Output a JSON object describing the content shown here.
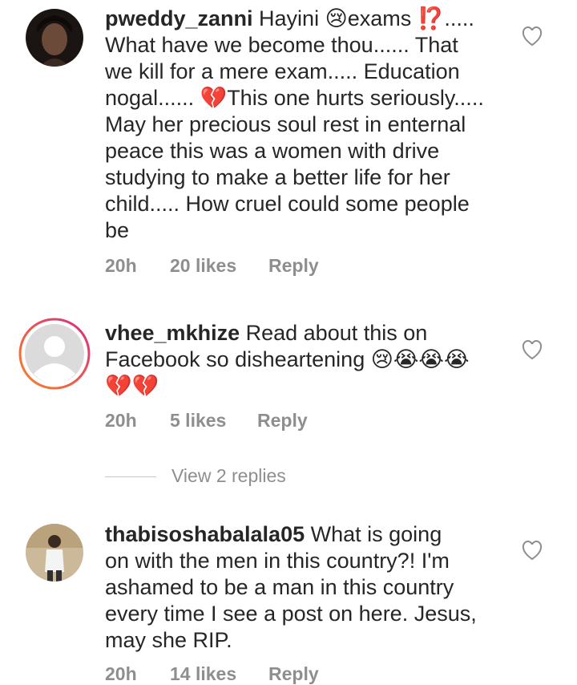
{
  "comments": [
    {
      "username": "pweddy_zanni",
      "text_lines": [
        "Hayini 😢exams ⁉️.....",
        "What have we become thou...... That",
        "we kill for a mere exam..... Education",
        "nogal...... 💔This one hurts seriously.....",
        "May her precious soul rest in enternal",
        "peace this was a women with drive",
        "studying to make a better life for her",
        "child..... How cruel could some people",
        "be"
      ],
      "time": "20h",
      "likes": "20 likes",
      "reply": "Reply"
    },
    {
      "username": "vhee_mkhize",
      "text_lines": [
        "Read about this on",
        "Facebook so disheartening 😢😭😭😭",
        "💔💔"
      ],
      "time": "20h",
      "likes": "5 likes",
      "reply": "Reply"
    },
    {
      "username": "thabisoshabalala05",
      "text_lines": [
        "What is going",
        "on with the men in this country?! I'm",
        "ashamed to be a man in this country",
        "every time I see a post on here. Jesus,",
        "may she RIP."
      ],
      "time": "20h",
      "likes": "14 likes",
      "reply": "Reply"
    }
  ],
  "view_replies": "View 2 replies",
  "icons": {
    "heart": "heart-outline-icon",
    "avatar_placeholder": "user-silhouette-icon"
  },
  "colors": {
    "text": "#262626",
    "muted": "#8e8e8e",
    "story_ring_start": "#f58529",
    "story_ring_end": "#dd2a7b"
  }
}
